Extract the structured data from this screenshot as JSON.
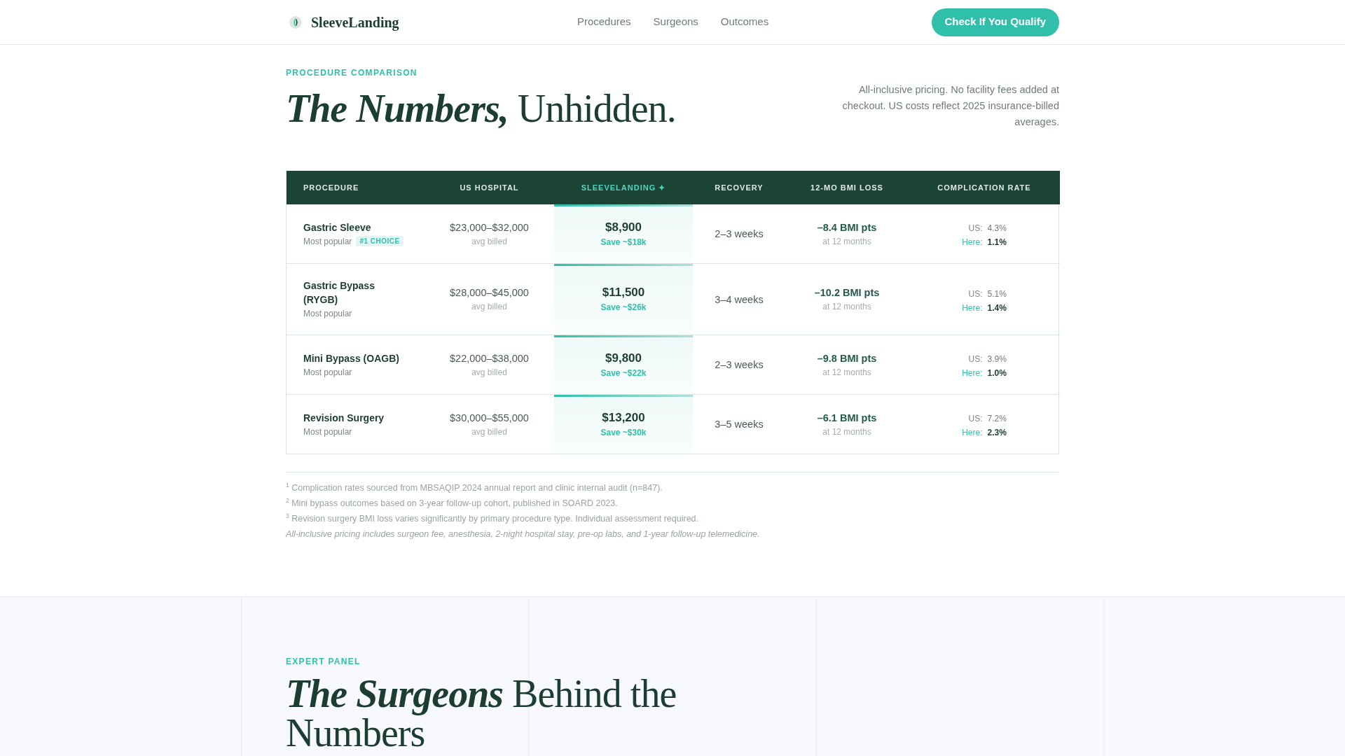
{
  "header": {
    "brand": "SleeveLanding",
    "nav": [
      "Procedures",
      "Surgeons",
      "Outcomes"
    ],
    "cta": "Check If You Qualify"
  },
  "comparison": {
    "eyebrow": "PROCEDURE COMPARISON",
    "title": {
      "emphasis": "The Numbers,",
      "rest": "Unhidden."
    },
    "intro": "All-inclusive pricing. No facility fees added at checkout. US costs reflect 2025 insurance-billed averages.",
    "table": {
      "columns": [
        {
          "label": "PROCEDURE",
          "highlighted": false
        },
        {
          "label": "US HOSPITAL",
          "highlighted": false
        },
        {
          "label": "SLEEVELANDING ✦",
          "highlighted": true
        },
        {
          "label": "RECOVERY",
          "highlighted": false
        },
        {
          "label": "12-MO BMI LOSS",
          "highlighted": false
        },
        {
          "label": "COMPLICATION RATE",
          "highlighted": false
        }
      ],
      "rows": [
        {
          "name": "Gastric Sleeve",
          "tag": "Most popular",
          "badge": "#1 CHOICE",
          "us_price": "$23,000–$32,000",
          "us_note": "avg billed",
          "price": "$8,900",
          "savings": "Save ~$18k",
          "recovery": "2–3 weeks",
          "bmi": "–8.4 BMI pts",
          "bmi_note": "at 12 months",
          "rates": [
            {
              "kind": "us",
              "label": "US:",
              "value": "4.3%"
            },
            {
              "kind": "clinic",
              "label": "Here:",
              "value": "1.1%"
            }
          ]
        },
        {
          "name": "Gastric Bypass (RYGB)",
          "tag": "Most popular",
          "us_price": "$28,000–$45,000",
          "us_note": "avg billed",
          "price": "$11,500",
          "savings": "Save ~$26k",
          "recovery": "3–4 weeks",
          "bmi": "–10.2 BMI pts",
          "bmi_note": "at 12 months",
          "rates": [
            {
              "kind": "us",
              "label": "US:",
              "value": "5.1%"
            },
            {
              "kind": "clinic",
              "label": "Here:",
              "value": "1.4%"
            }
          ]
        },
        {
          "name": "Mini Bypass (OAGB)",
          "tag": "Most popular",
          "us_price": "$22,000–$38,000",
          "us_note": "avg billed",
          "price": "$9,800",
          "savings": "Save ~$22k",
          "recovery": "2–3 weeks",
          "bmi": "–9.8 BMI pts",
          "bmi_note": "at 12 months",
          "rates": [
            {
              "kind": "us",
              "label": "US:",
              "value": "3.9%"
            },
            {
              "kind": "clinic",
              "label": "Here:",
              "value": "1.0%"
            }
          ]
        },
        {
          "name": "Revision Surgery",
          "tag": "Most popular",
          "us_price": "$30,000–$55,000",
          "us_note": "avg billed",
          "price": "$13,200",
          "savings": "Save ~$30k",
          "recovery": "3–5 weeks",
          "bmi": "–6.1 BMI pts",
          "bmi_note": "at 12 months",
          "rates": [
            {
              "kind": "us",
              "label": "US:",
              "value": "7.2%"
            },
            {
              "kind": "clinic",
              "label": "Here:",
              "value": "2.3%"
            }
          ]
        }
      ]
    },
    "footnotes": [
      "$^{1}$ Complication rates sourced from MBSAQIP 2024 annual report and clinic internal audit (n=847).",
      "$^{2}$ Mini bypass outcomes based on 3-year follow-up cohort, published in SOARD 2023.",
      "$^{3}$ Revision surgery BMI loss varies significantly by primary procedure type. Individual assessment required."
    ],
    "disclaimer": "All-inclusive pricing includes surgeon fee, anesthesia, 2-night hospital stay, pre-op labs, and 1-year follow-up telemedicine."
  },
  "expert_panel": {
    "eyebrow": "EXPERT PANEL",
    "title": {
      "emphasis": "The Surgeons",
      "rest": "Behind the Numbers"
    }
  }
}
